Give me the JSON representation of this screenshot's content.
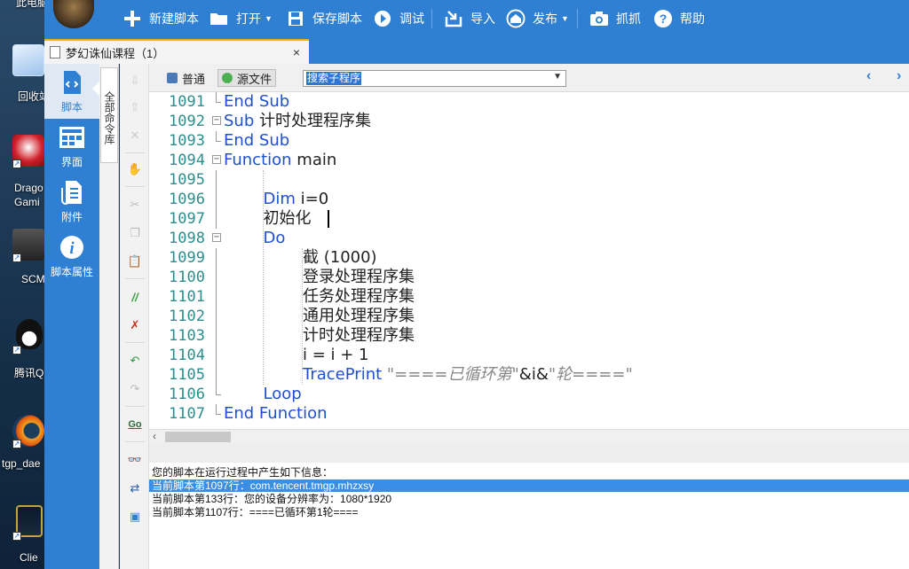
{
  "desktop": {
    "items": [
      {
        "label": "此电脑",
        "icon": "computer-icon"
      },
      {
        "label": "回收站",
        "icon": "recycle-bin-icon"
      },
      {
        "label": "Drago Gami",
        "icon": "dragon-game-icon"
      },
      {
        "label": "SCM",
        "icon": "scm-icon"
      },
      {
        "label": "腾讯Q",
        "icon": "qq-penguin-icon"
      },
      {
        "label": "tgp_dae",
        "icon": "tgp-icon"
      },
      {
        "label": "Clie",
        "icon": "league-client-icon"
      }
    ]
  },
  "toolbar": {
    "new_script": "新建脚本",
    "open": "打开",
    "save_script": "保存脚本",
    "debug": "调试",
    "import": "导入",
    "publish": "发布",
    "capture": "抓抓",
    "help": "帮助"
  },
  "tab": {
    "title": "梦幻诛仙课程（1）",
    "close": "×"
  },
  "leftnav": {
    "items": [
      {
        "label": "脚本",
        "icon": "script-code-icon"
      },
      {
        "label": "界面",
        "icon": "layout-grid-icon"
      },
      {
        "label": "附件",
        "icon": "attachment-icon"
      },
      {
        "label": "脚本属性",
        "icon": "info-icon"
      }
    ]
  },
  "cmdlib": {
    "label": "全部命令库"
  },
  "editor": {
    "view_normal": "普通",
    "view_source": "源文件",
    "search_placeholder": "搜索子程序",
    "lines": [
      {
        "n": "1091",
        "parts": [
          {
            "t": "End Sub",
            "c": "kw"
          }
        ]
      },
      {
        "n": "1092",
        "parts": [
          {
            "t": "Sub",
            "c": "kw"
          },
          {
            "t": " 计时处理程序集",
            "c": ""
          }
        ]
      },
      {
        "n": "1093",
        "parts": [
          {
            "t": "End Sub",
            "c": "kw"
          }
        ]
      },
      {
        "n": "1094",
        "parts": [
          {
            "t": "Function",
            "c": "kw"
          },
          {
            "t": " main",
            "c": ""
          }
        ]
      },
      {
        "n": "1095",
        "parts": []
      },
      {
        "n": "1096",
        "parts": [
          {
            "t": "Dim",
            "c": "kw"
          },
          {
            "t": " i=0",
            "c": ""
          }
        ]
      },
      {
        "n": "1097",
        "parts": [
          {
            "t": "初始化",
            "c": ""
          }
        ]
      },
      {
        "n": "1098",
        "parts": [
          {
            "t": "Do",
            "c": "kw"
          }
        ]
      },
      {
        "n": "1099",
        "parts": [
          {
            "t": "截 (1000)",
            "c": ""
          }
        ]
      },
      {
        "n": "1100",
        "parts": [
          {
            "t": "登录处理程序集",
            "c": ""
          }
        ]
      },
      {
        "n": "1101",
        "parts": [
          {
            "t": "任务处理程序集",
            "c": ""
          }
        ]
      },
      {
        "n": "1102",
        "parts": [
          {
            "t": "通用处理程序集",
            "c": ""
          }
        ]
      },
      {
        "n": "1103",
        "parts": [
          {
            "t": "计时处理程序集",
            "c": ""
          }
        ]
      },
      {
        "n": "1104",
        "parts": [
          {
            "t": "i = i + 1",
            "c": ""
          }
        ]
      },
      {
        "n": "1105",
        "parts": [
          {
            "t": "TracePrint",
            "c": "kw"
          },
          {
            "t": " ",
            "c": ""
          },
          {
            "t": "\"====已循环第\"",
            "c": "str"
          },
          {
            "t": "&i&",
            "c": ""
          },
          {
            "t": "\"轮====\"",
            "c": "str"
          }
        ]
      },
      {
        "n": "1106",
        "parts": [
          {
            "t": "Loop",
            "c": "kw"
          }
        ]
      },
      {
        "n": "1107",
        "parts": [
          {
            "t": "End Function",
            "c": "kw"
          }
        ]
      }
    ]
  },
  "output": {
    "lines": [
      "您的脚本在运行过程中产生如下信息：",
      "当前脚本第1097行：com.tencent.tmgp.mhzxsy",
      "当前脚本第133行：您的设备分辨率为：1080*1920",
      "当前脚本第1107行：====已循环第1轮===="
    ]
  }
}
